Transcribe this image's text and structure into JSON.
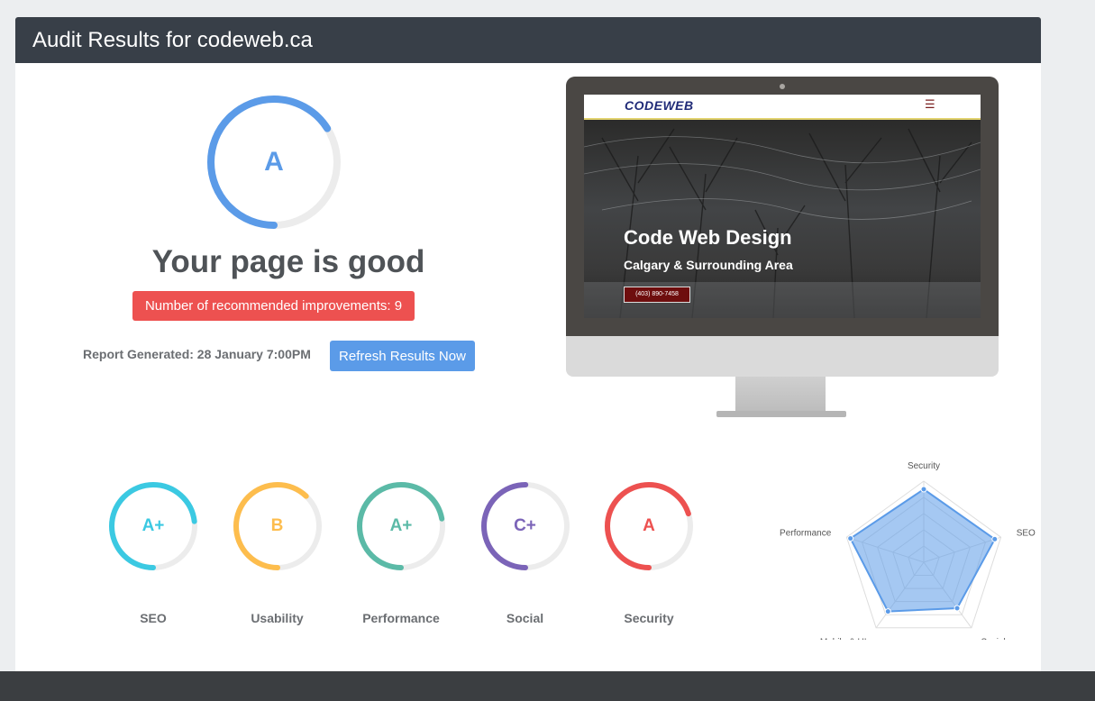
{
  "header": {
    "title": "Audit Results for codeweb.ca"
  },
  "summary": {
    "grade": "A",
    "score_fraction": 0.66,
    "verdict": "Your page is good",
    "improvements_label": "Number of recommended improvements: 9",
    "report_generated": "Report Generated: 28 January 7:00PM",
    "refresh_label": "Refresh Results Now"
  },
  "preview": {
    "logo": "CODEWEB",
    "menu_icon": "hamburger-menu-icon",
    "hero_title": "Code Web Design",
    "hero_subtitle": "Calgary & Surrounding Area",
    "phone": "(403) 890-7458"
  },
  "categories": [
    {
      "label": "SEO",
      "grade": "A+",
      "score_fraction": 0.73,
      "color": "#3bc9e2"
    },
    {
      "label": "Usability",
      "grade": "B",
      "score_fraction": 0.62,
      "color": "#fdbd4d"
    },
    {
      "label": "Performance",
      "grade": "A+",
      "score_fraction": 0.72,
      "color": "#5bbaa7"
    },
    {
      "label": "Social",
      "grade": "C+",
      "score_fraction": 0.5,
      "color": "#7b64b8"
    },
    {
      "label": "Security",
      "grade": "A",
      "score_fraction": 0.7,
      "color": "#ed5150"
    }
  ],
  "chart_data": {
    "type": "radar",
    "axes": [
      "Security",
      "SEO",
      "Social",
      "Mobile & UI",
      "Performance"
    ],
    "values": [
      0.9,
      0.92,
      0.7,
      0.75,
      0.95
    ],
    "scale_max": 1,
    "grid_levels": 5,
    "color": "#5b9be8"
  }
}
